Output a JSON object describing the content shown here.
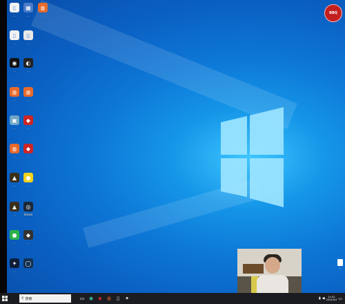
{
  "desktop_icons": [
    {
      "label": "...",
      "color": "#f2f2f2",
      "glyph": "▯"
    },
    {
      "label": "...",
      "color": "#4a7cc9",
      "glyph": "▦"
    },
    {
      "label": "...",
      "color": "#e86a2c",
      "glyph": "◍"
    },
    {
      "label": "...",
      "color": "#f2f2f2",
      "glyph": "▯"
    },
    {
      "label": "...",
      "color": "#e8e8e8",
      "glyph": "▯"
    },
    {
      "label": "...",
      "color": "#111111",
      "glyph": "◉"
    },
    {
      "label": "...",
      "color": "#222222",
      "glyph": "◐"
    },
    {
      "label": "...",
      "color": "#e86a2c",
      "glyph": "◍"
    },
    {
      "label": "...",
      "color": "#e86a2c",
      "glyph": "◍"
    },
    {
      "label": "...",
      "color": "#6fa6c7",
      "glyph": "▣"
    },
    {
      "label": "...",
      "color": "#cc2525",
      "glyph": "◆"
    },
    {
      "label": "...",
      "color": "#e86a2c",
      "glyph": "◍"
    },
    {
      "label": "...",
      "color": "#cc2525",
      "glyph": "◆"
    },
    {
      "label": "...",
      "color": "#3a2f1a",
      "glyph": "▲"
    },
    {
      "label": "...",
      "color": "#f2d21a",
      "glyph": "●"
    },
    {
      "label": "...",
      "color": "#3a2f1a",
      "glyph": "▲"
    },
    {
      "label": "Steam",
      "color": "#1b2838",
      "glyph": "◎"
    },
    {
      "label": "...",
      "color": "#2bb24c",
      "glyph": "●"
    },
    {
      "label": "...",
      "color": "#333333",
      "glyph": "◆"
    },
    {
      "label": "...",
      "color": "#0f1d3a",
      "glyph": "✦"
    },
    {
      "label": "...",
      "color": "#12304f",
      "glyph": "◯"
    }
  ],
  "corner_badge": "BBQ",
  "right_file_label": "...",
  "taskbar": {
    "search_placeholder": "搜索",
    "time": "21:02",
    "date": "2024/5/3"
  }
}
